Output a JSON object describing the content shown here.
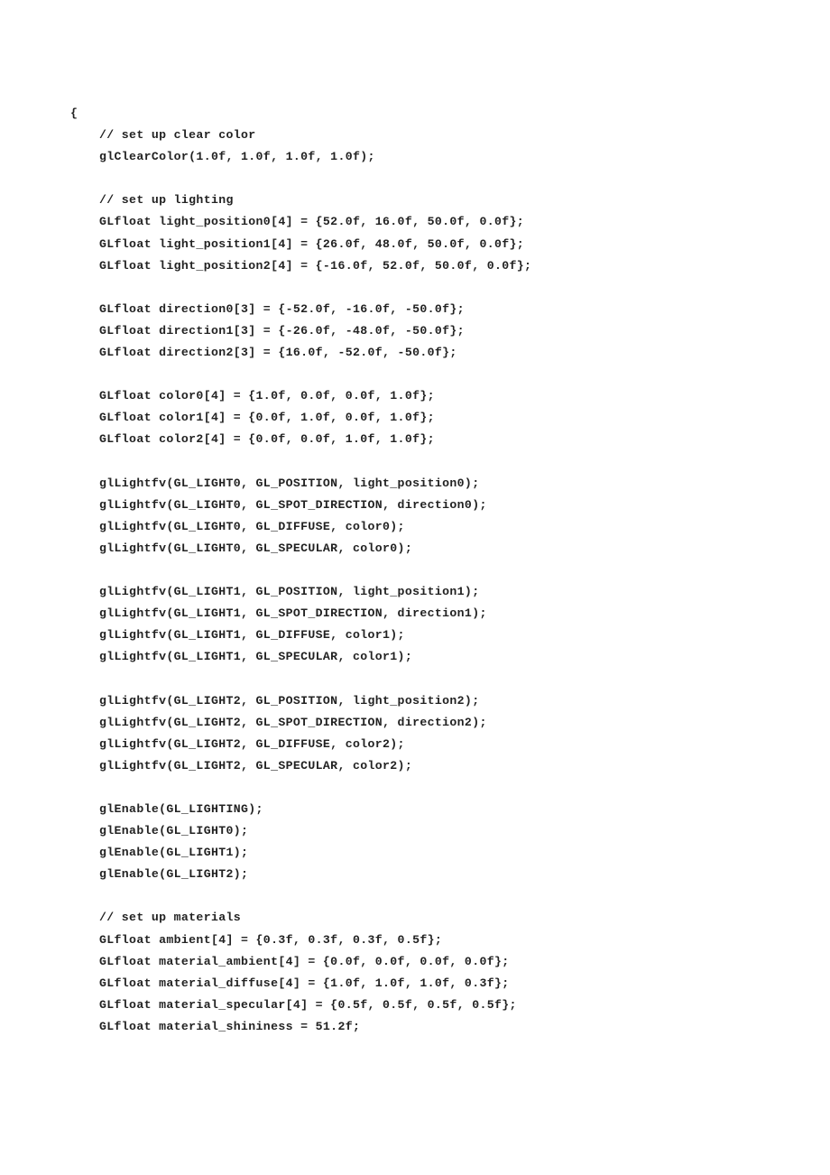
{
  "document": {
    "lines": [
      {
        "indent": 0,
        "text": "{"
      },
      {
        "indent": 1,
        "text": "// set up clear color"
      },
      {
        "indent": 1,
        "text": "glClearColor(1.0f, 1.0f, 1.0f, 1.0f);"
      },
      {
        "indent": 1,
        "text": ""
      },
      {
        "indent": 1,
        "text": "// set up lighting"
      },
      {
        "indent": 1,
        "text": "GLfloat light_position0[4] = {52.0f, 16.0f, 50.0f, 0.0f};"
      },
      {
        "indent": 1,
        "text": "GLfloat light_position1[4] = {26.0f, 48.0f, 50.0f, 0.0f};"
      },
      {
        "indent": 1,
        "text": "GLfloat light_position2[4] = {-16.0f, 52.0f, 50.0f, 0.0f};"
      },
      {
        "indent": 1,
        "text": ""
      },
      {
        "indent": 1,
        "text": "GLfloat direction0[3] = {-52.0f, -16.0f, -50.0f};"
      },
      {
        "indent": 1,
        "text": "GLfloat direction1[3] = {-26.0f, -48.0f, -50.0f};"
      },
      {
        "indent": 1,
        "text": "GLfloat direction2[3] = {16.0f, -52.0f, -50.0f};"
      },
      {
        "indent": 1,
        "text": ""
      },
      {
        "indent": 1,
        "text": "GLfloat color0[4] = {1.0f, 0.0f, 0.0f, 1.0f};"
      },
      {
        "indent": 1,
        "text": "GLfloat color1[4] = {0.0f, 1.0f, 0.0f, 1.0f};"
      },
      {
        "indent": 1,
        "text": "GLfloat color2[4] = {0.0f, 0.0f, 1.0f, 1.0f};"
      },
      {
        "indent": 1,
        "text": ""
      },
      {
        "indent": 1,
        "text": "glLightfv(GL_LIGHT0, GL_POSITION, light_position0);"
      },
      {
        "indent": 1,
        "text": "glLightfv(GL_LIGHT0, GL_SPOT_DIRECTION, direction0);"
      },
      {
        "indent": 1,
        "text": "glLightfv(GL_LIGHT0, GL_DIFFUSE, color0);"
      },
      {
        "indent": 1,
        "text": "glLightfv(GL_LIGHT0, GL_SPECULAR, color0);"
      },
      {
        "indent": 1,
        "text": ""
      },
      {
        "indent": 1,
        "text": "glLightfv(GL_LIGHT1, GL_POSITION, light_position1);"
      },
      {
        "indent": 1,
        "text": "glLightfv(GL_LIGHT1, GL_SPOT_DIRECTION, direction1);"
      },
      {
        "indent": 1,
        "text": "glLightfv(GL_LIGHT1, GL_DIFFUSE, color1);"
      },
      {
        "indent": 1,
        "text": "glLightfv(GL_LIGHT1, GL_SPECULAR, color1);"
      },
      {
        "indent": 1,
        "text": ""
      },
      {
        "indent": 1,
        "text": "glLightfv(GL_LIGHT2, GL_POSITION, light_position2);"
      },
      {
        "indent": 1,
        "text": "glLightfv(GL_LIGHT2, GL_SPOT_DIRECTION, direction2);"
      },
      {
        "indent": 1,
        "text": "glLightfv(GL_LIGHT2, GL_DIFFUSE, color2);"
      },
      {
        "indent": 1,
        "text": "glLightfv(GL_LIGHT2, GL_SPECULAR, color2);"
      },
      {
        "indent": 1,
        "text": ""
      },
      {
        "indent": 1,
        "text": "glEnable(GL_LIGHTING);"
      },
      {
        "indent": 1,
        "text": "glEnable(GL_LIGHT0);"
      },
      {
        "indent": 1,
        "text": "glEnable(GL_LIGHT1);"
      },
      {
        "indent": 1,
        "text": "glEnable(GL_LIGHT2);"
      },
      {
        "indent": 1,
        "text": ""
      },
      {
        "indent": 1,
        "text": "// set up materials"
      },
      {
        "indent": 1,
        "text": "GLfloat ambient[4] = {0.3f, 0.3f, 0.3f, 0.5f};"
      },
      {
        "indent": 1,
        "text": "GLfloat material_ambient[4] = {0.0f, 0.0f, 0.0f, 0.0f};"
      },
      {
        "indent": 1,
        "text": "GLfloat material_diffuse[4] = {1.0f, 1.0f, 1.0f, 0.3f};"
      },
      {
        "indent": 1,
        "text": "GLfloat material_specular[4] = {0.5f, 0.5f, 0.5f, 0.5f};"
      },
      {
        "indent": 1,
        "text": "GLfloat material_shininess = 51.2f;"
      }
    ]
  }
}
